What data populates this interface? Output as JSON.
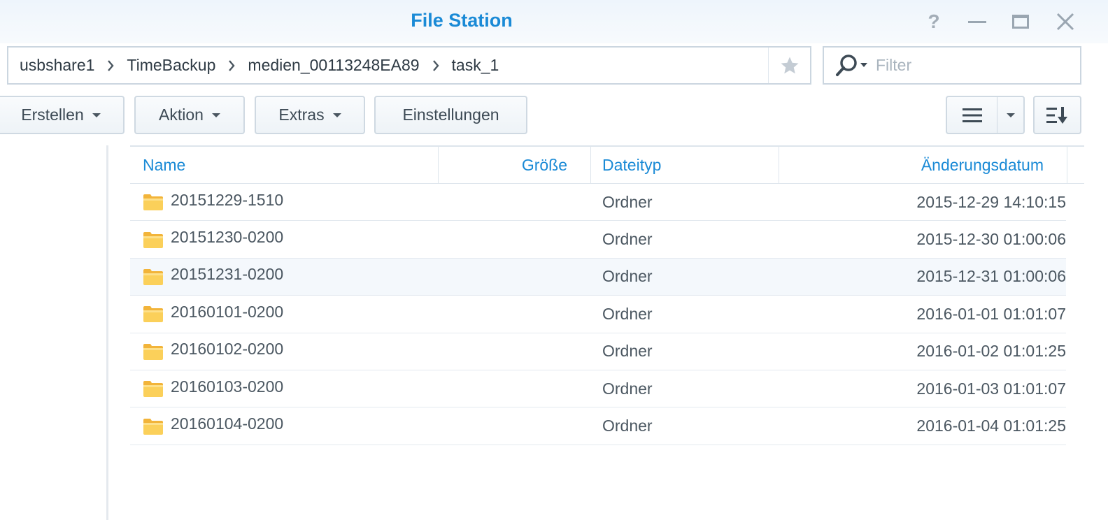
{
  "window": {
    "title": "File Station",
    "help_symbol": "?"
  },
  "path": {
    "crumbs": [
      "usbshare1",
      "TimeBackup",
      "medien_00113248EA89",
      "task_1"
    ]
  },
  "filter": {
    "placeholder": "Filter"
  },
  "toolbar": {
    "create_label": "Erstellen",
    "action_label": "Aktion",
    "extras_label": "Extras",
    "settings_label": "Einstellungen"
  },
  "table": {
    "columns": {
      "name": "Name",
      "size": "Größe",
      "type": "Dateityp",
      "modified": "Änderungsdatum"
    },
    "rows": [
      {
        "name": "20151229-1510",
        "size": "",
        "type": "Ordner",
        "modified": "2015-12-29 14:10:15"
      },
      {
        "name": "20151230-0200",
        "size": "",
        "type": "Ordner",
        "modified": "2015-12-30 01:00:06"
      },
      {
        "name": "20151231-0200",
        "size": "",
        "type": "Ordner",
        "modified": "2015-12-31 01:00:06"
      },
      {
        "name": "20160101-0200",
        "size": "",
        "type": "Ordner",
        "modified": "2016-01-01 01:01:07"
      },
      {
        "name": "20160102-0200",
        "size": "",
        "type": "Ordner",
        "modified": "2016-01-02 01:01:25"
      },
      {
        "name": "20160103-0200",
        "size": "",
        "type": "Ordner",
        "modified": "2016-01-03 01:01:07"
      },
      {
        "name": "20160104-0200",
        "size": "",
        "type": "Ordner",
        "modified": "2016-01-04 01:01:25"
      }
    ]
  },
  "colors": {
    "accent": "#1a8ad6",
    "folder": "#f9c642"
  },
  "icons": {
    "folder": "folder-icon",
    "search": "search-icon",
    "star": "star-icon",
    "list_view": "list-view-icon",
    "sort": "sort-icon"
  }
}
